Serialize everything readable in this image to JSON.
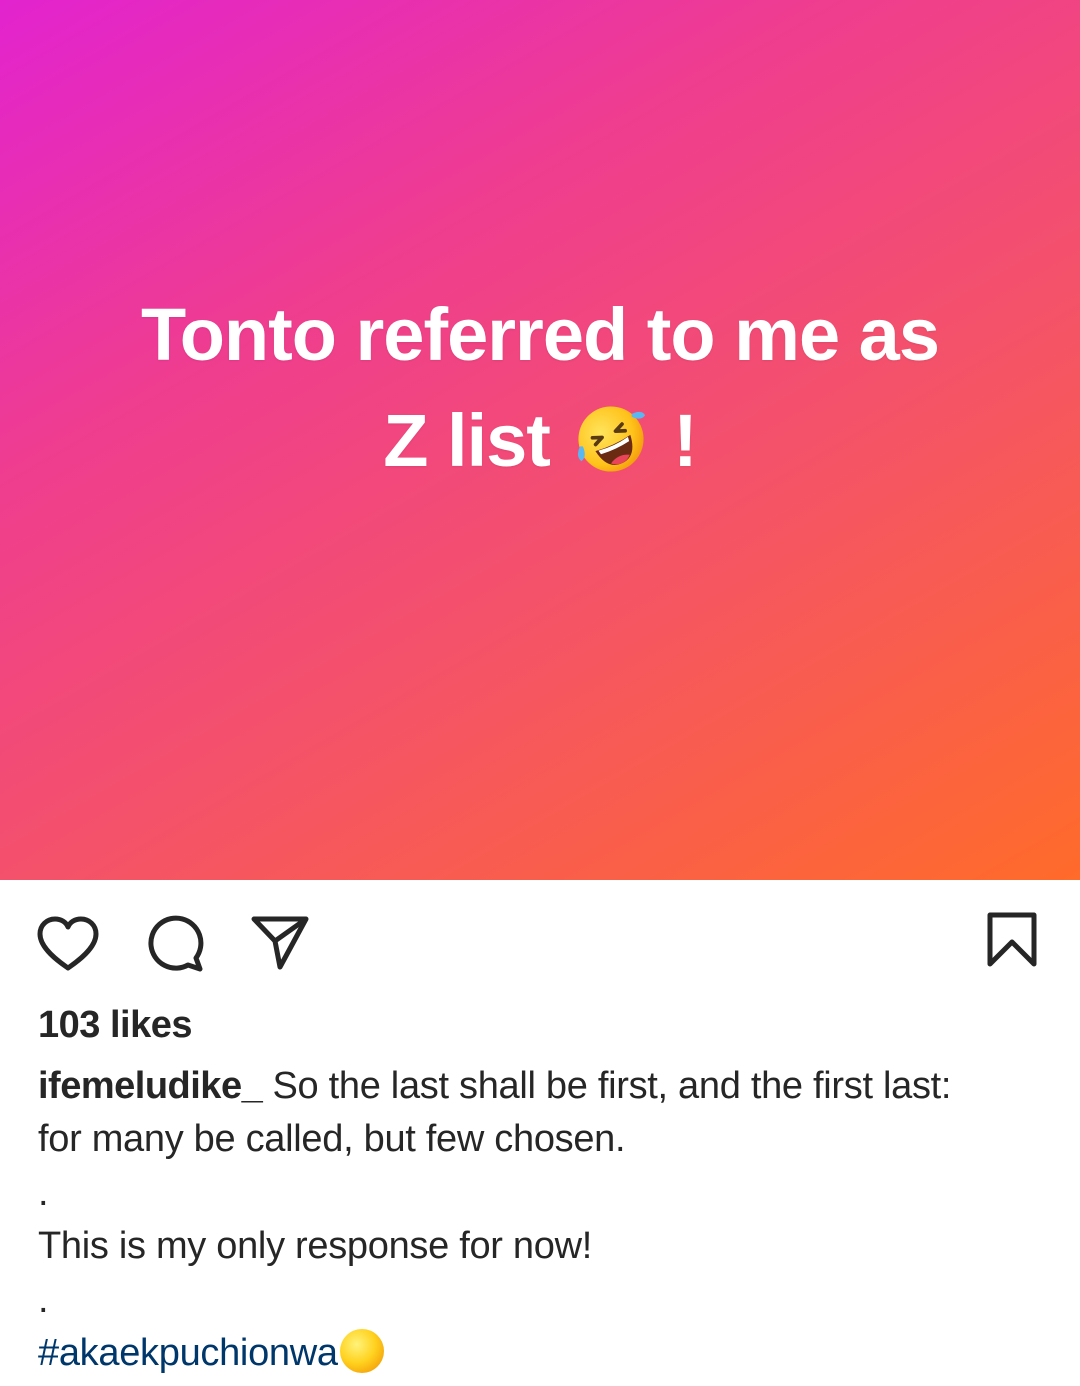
{
  "post": {
    "image": {
      "text_line1": "Tonto referred to me as",
      "text_line2": "Z list",
      "text_suffix": "!",
      "emoji": "rolling-on-floor-laughing",
      "gradient_colors": [
        "#e223cf",
        "#ef3d8f",
        "#f4526a",
        "#ff6b2a"
      ]
    },
    "actions": {
      "like_icon": "heart-icon",
      "comment_icon": "comment-icon",
      "share_icon": "send-icon",
      "save_icon": "bookmark-icon"
    },
    "likes_text": "103 likes",
    "caption": {
      "username": "ifemeludike_",
      "line1": "So the last shall be first, and the first last:",
      "line2": "for many be called, but few chosen.",
      "separator1": ".",
      "line3": "This is my only response for now!",
      "separator2": ".",
      "hashtag": "#akaekpuchionwa",
      "hashtag_emoji": "yellow-circle-emoji"
    },
    "colors": {
      "text": "#262626",
      "hashtag": "#00376b"
    }
  }
}
